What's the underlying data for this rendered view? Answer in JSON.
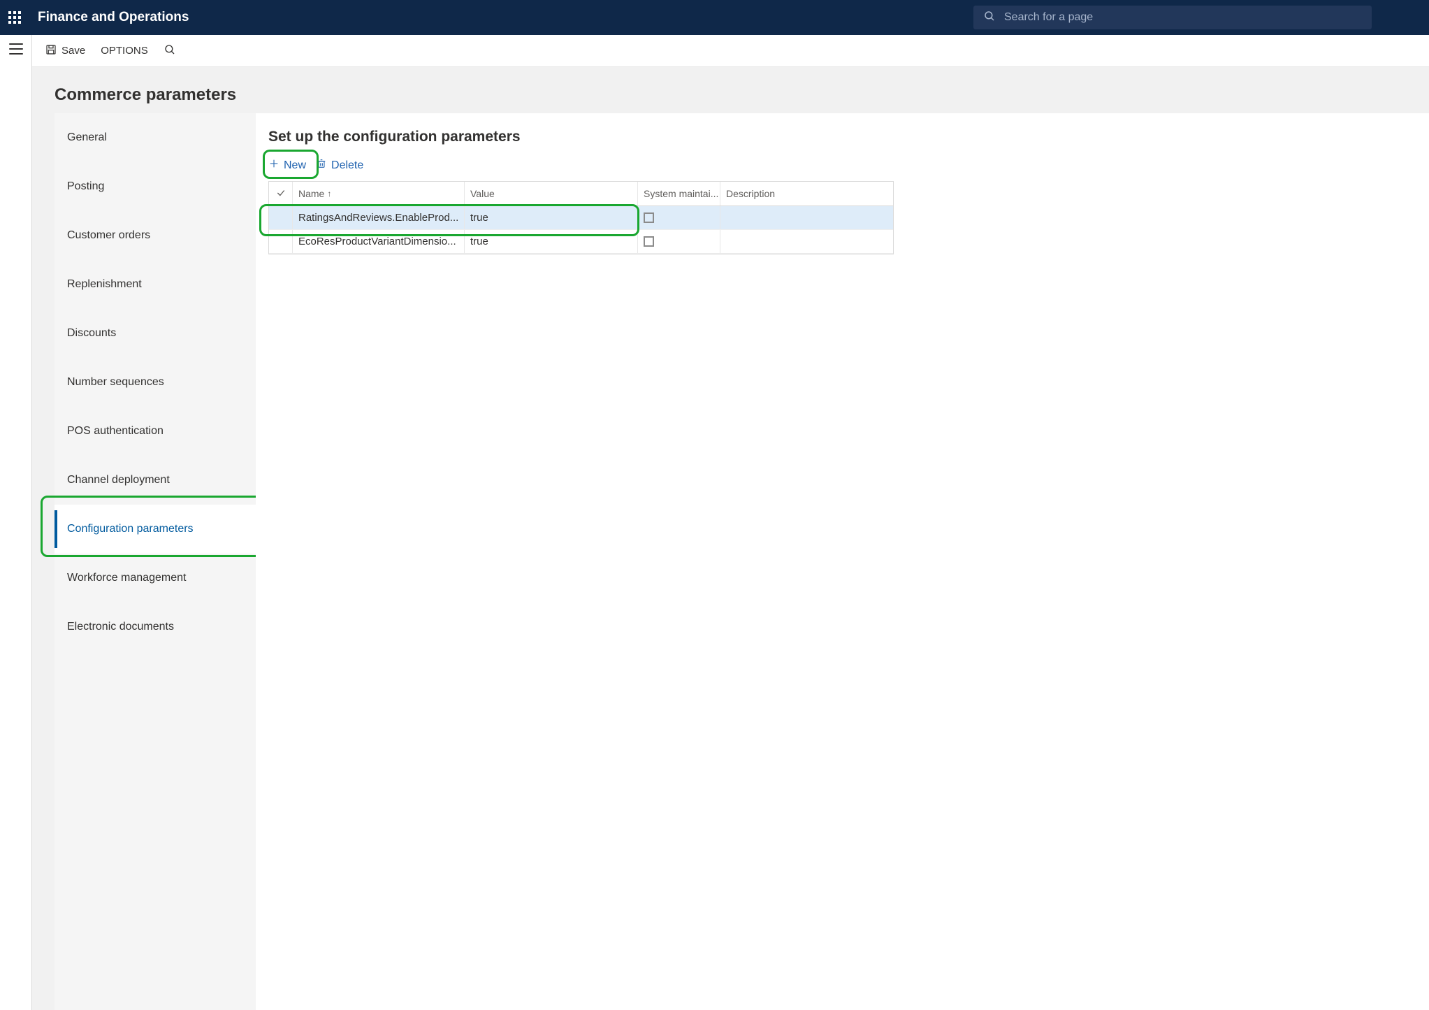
{
  "header": {
    "app_title": "Finance and Operations",
    "search_placeholder": "Search for a page"
  },
  "actionbar": {
    "save_label": "Save",
    "options_label": "OPTIONS"
  },
  "page": {
    "title": "Commerce parameters"
  },
  "sidebar": {
    "items": [
      {
        "label": "General",
        "selected": false
      },
      {
        "label": "Posting",
        "selected": false
      },
      {
        "label": "Customer orders",
        "selected": false
      },
      {
        "label": "Replenishment",
        "selected": false
      },
      {
        "label": "Discounts",
        "selected": false
      },
      {
        "label": "Number sequences",
        "selected": false
      },
      {
        "label": "POS authentication",
        "selected": false
      },
      {
        "label": "Channel deployment",
        "selected": false
      },
      {
        "label": "Configuration parameters",
        "selected": true
      },
      {
        "label": "Workforce management",
        "selected": false
      },
      {
        "label": "Electronic documents",
        "selected": false
      }
    ]
  },
  "panel": {
    "title": "Set up the configuration parameters",
    "new_label": "New",
    "delete_label": "Delete"
  },
  "grid": {
    "columns": {
      "name": "Name",
      "value": "Value",
      "system": "System maintai...",
      "description": "Description"
    },
    "rows": [
      {
        "name": "RatingsAndReviews.EnableProd...",
        "value": "true",
        "system_maintained": false,
        "description": "",
        "selected": true
      },
      {
        "name": "EcoResProductVariantDimensio...",
        "value": "true",
        "system_maintained": false,
        "description": "",
        "selected": false
      }
    ]
  }
}
